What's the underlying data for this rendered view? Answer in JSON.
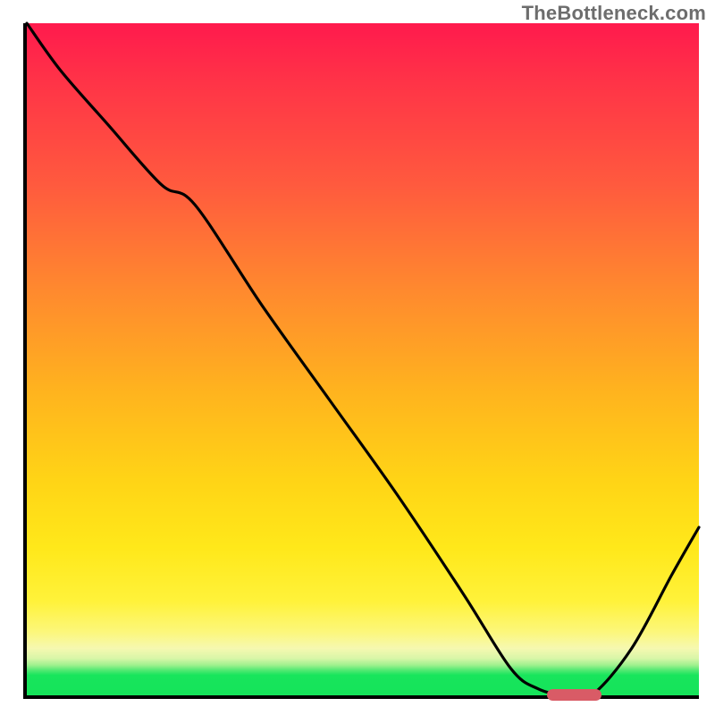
{
  "watermark": "TheBottleneck.com",
  "chart_data": {
    "type": "line",
    "title": "",
    "xlabel": "",
    "ylabel": "",
    "xlim": [
      0,
      100
    ],
    "ylim": [
      0,
      100
    ],
    "grid": false,
    "background_gradient": {
      "direction": "vertical",
      "stops": [
        {
          "pos": 0,
          "color": "#ff1a4d"
        },
        {
          "pos": 0.4,
          "color": "#ff8a2e"
        },
        {
          "pos": 0.78,
          "color": "#ffe81a"
        },
        {
          "pos": 0.93,
          "color": "#f6f8b0"
        },
        {
          "pos": 0.97,
          "color": "#18e55c"
        },
        {
          "pos": 1.0,
          "color": "#15e35a"
        }
      ]
    },
    "series": [
      {
        "name": "bottleneck-curve",
        "color": "#000000",
        "x": [
          0,
          5,
          12,
          20,
          25,
          35,
          45,
          55,
          65,
          72,
          76,
          80,
          84,
          90,
          96,
          100
        ],
        "y": [
          100,
          93,
          85,
          76,
          73,
          58,
          44,
          30,
          15,
          4,
          1,
          0,
          0,
          7,
          18,
          25
        ]
      }
    ],
    "marker": {
      "name": "optimal-range",
      "color": "#d95b66",
      "x_start": 77,
      "x_end": 85,
      "y": 0.5
    }
  }
}
